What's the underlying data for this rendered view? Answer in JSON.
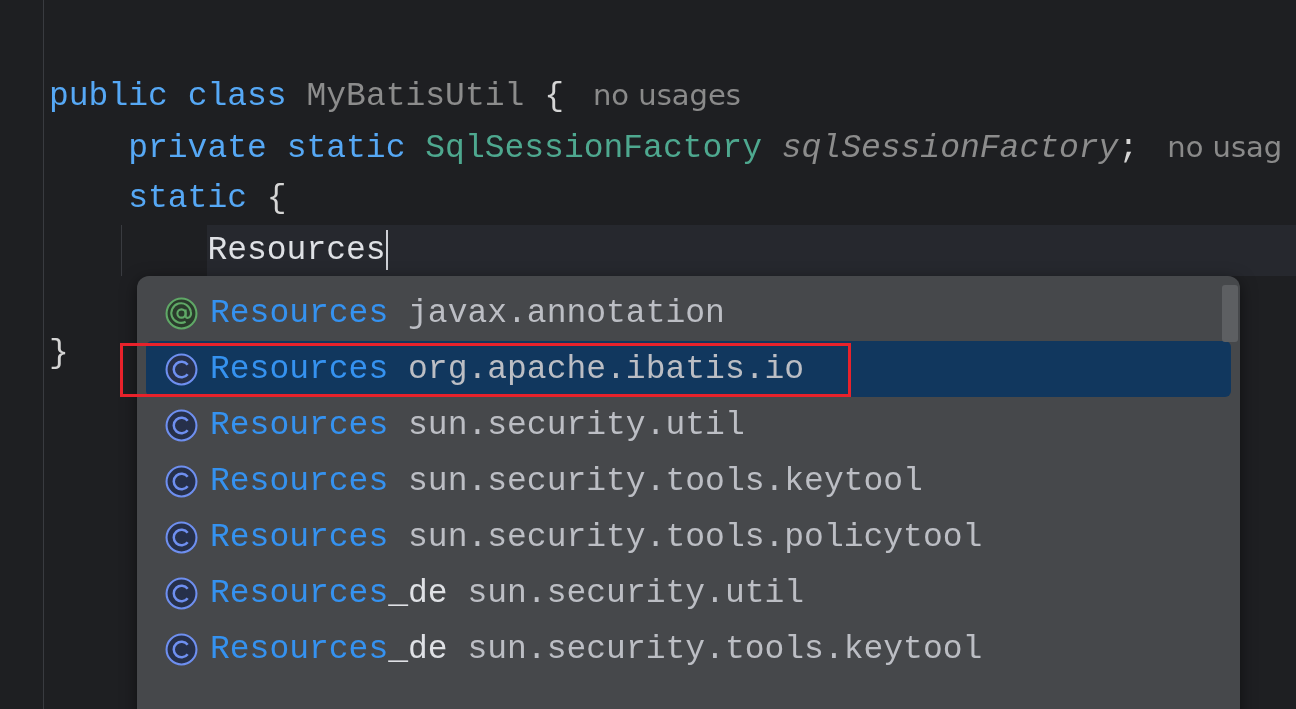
{
  "editor": {
    "lines": [
      {
        "kind": "blank"
      },
      {
        "kind": "blank"
      },
      {
        "kind": "code",
        "tokens": [
          {
            "text": "public",
            "kind": "keyword"
          },
          {
            "text": "class",
            "kind": "keyword"
          },
          {
            "text": "MyBatisUtil",
            "kind": "unused"
          },
          {
            "text": "{",
            "kind": "punct"
          },
          {
            "text": "no usages",
            "kind": "hint"
          }
        ],
        "children": [
          {
            "kind": "code",
            "tokens": [
              {
                "text": "private",
                "kind": "keyword"
              },
              {
                "text": "static",
                "kind": "keyword"
              },
              {
                "text": "SqlSessionFactory",
                "kind": "type"
              },
              {
                "text": "sqlSessionFactory",
                "kind": "field"
              },
              {
                "text": ";",
                "kind": "punct",
                "attach": true
              },
              {
                "text": "no usag",
                "kind": "hint"
              }
            ]
          },
          {
            "kind": "code",
            "tokens": [
              {
                "text": "static",
                "kind": "keyword"
              },
              {
                "text": "{",
                "kind": "punct"
              }
            ],
            "children": [
              {
                "kind": "code",
                "current": true,
                "caret": true,
                "tokens": [
                  {
                    "text": "Resources",
                    "kind": "plain"
                  }
                ]
              }
            ]
          },
          {
            "kind": "blank"
          }
        ]
      },
      {
        "kind": "code",
        "tokens": [
          {
            "text": "}",
            "kind": "punct"
          }
        ]
      }
    ]
  },
  "completion_popup": {
    "items": [
      {
        "kind": "annotation",
        "name": "Resources",
        "package": "javax.annotation",
        "selected": false,
        "annotated": false
      },
      {
        "kind": "class",
        "name": "Resources",
        "package": "org.apache.ibatis.io",
        "selected": true,
        "annotated": true
      },
      {
        "kind": "class",
        "name": "Resources",
        "package": "sun.security.util",
        "selected": false,
        "annotated": false
      },
      {
        "kind": "class",
        "name": "Resources",
        "package": "sun.security.tools.keytool",
        "selected": false,
        "annotated": false
      },
      {
        "kind": "class",
        "name": "Resources",
        "package": "sun.security.tools.policytool",
        "selected": false,
        "annotated": false
      },
      {
        "kind": "class",
        "name": "Resources",
        "suffix": "_de",
        "package": "sun.security.util",
        "selected": false,
        "annotated": false
      },
      {
        "kind": "class",
        "name": "Resources",
        "suffix": "_de",
        "package": "sun.security.tools.keytool",
        "selected": false,
        "annotated": false
      }
    ]
  }
}
